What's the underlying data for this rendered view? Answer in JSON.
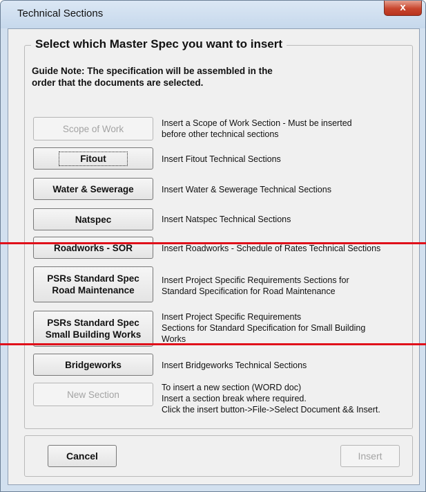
{
  "window": {
    "title": "Technical Sections",
    "close_glyph": "x"
  },
  "group": {
    "title": "Select which Master Spec you want to insert",
    "guide_line1": "Guide Note: The specification will be assembled in the",
    "guide_line2": "order that the documents are selected."
  },
  "sections": [
    {
      "label": "Scope of Work",
      "enabled": false,
      "desc": [
        "Insert a Scope of Work Section - Must be inserted",
        "before other technical sections"
      ]
    },
    {
      "label": "Fitout",
      "enabled": true,
      "focused": true,
      "desc": [
        "Insert Fitout Technical Sections"
      ]
    },
    {
      "label": "Water & Sewerage",
      "enabled": true,
      "desc": [
        "Insert Water & Sewerage Technical Sections"
      ]
    },
    {
      "label": "Natspec",
      "enabled": true,
      "desc": [
        "Insert Natspec Technical Sections"
      ]
    },
    {
      "label": "Roadworks - SOR",
      "enabled": true,
      "desc": [
        "Insert Roadworks - Schedule of Rates Technical Sections"
      ]
    },
    {
      "label_line1": "PSRs Standard Spec",
      "label_line2": "Road Maintenance",
      "enabled": true,
      "desc": [
        "Insert Project Specific Requirements Sections for",
        "Standard Specification for Road Maintenance"
      ]
    },
    {
      "label_line1": "PSRs Standard Spec",
      "label_line2": "Small Building Works",
      "enabled": true,
      "desc": [
        "Insert Project Specific Requirements",
        "Sections for Standard Specification for Small Building",
        "Works"
      ]
    },
    {
      "label": "Bridgeworks",
      "enabled": true,
      "desc": [
        "Insert Bridgeworks Technical Sections"
      ]
    },
    {
      "label": "New Section",
      "enabled": false,
      "desc": [
        "To insert a new section (WORD doc)",
        "Insert a section break where required.",
        "Click the insert button->File->Select Document && Insert."
      ]
    }
  ],
  "footer": {
    "cancel_label": "Cancel",
    "insert_label": "Insert",
    "insert_enabled": false
  },
  "colors": {
    "highlight_line": "#e0101a"
  }
}
